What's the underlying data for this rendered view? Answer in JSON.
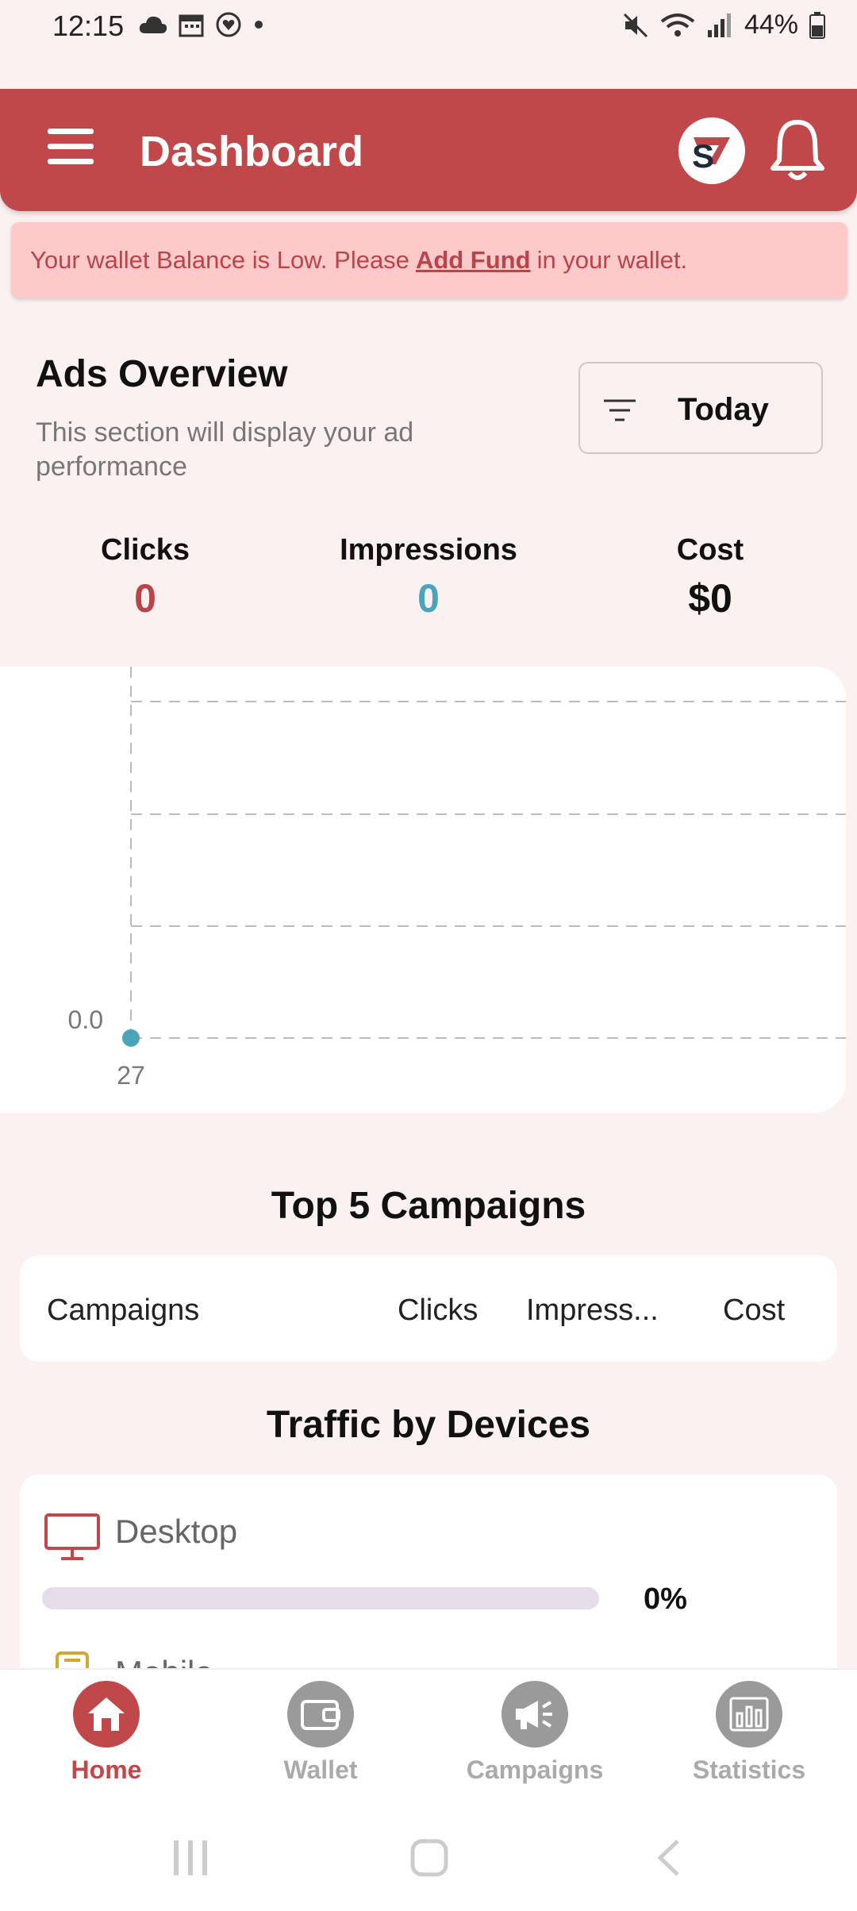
{
  "status_bar": {
    "time": "12:15",
    "battery": "44%"
  },
  "header": {
    "title": "Dashboard",
    "profile_logo_text": "S"
  },
  "alert": {
    "prefix": "Your wallet Balance is Low. Please",
    "link": "Add Fund",
    "suffix": "in your wallet."
  },
  "overview": {
    "title": "Ads Overview",
    "subtitle": "This section will display your ad performance",
    "filter_label": "Today",
    "metrics": [
      {
        "label": "Clicks",
        "value": "0",
        "color": "#b9444a"
      },
      {
        "label": "Impressions",
        "value": "0",
        "color": "#4aa5bb"
      },
      {
        "label": "Cost",
        "value": "$0",
        "color": "#111111"
      }
    ]
  },
  "chart_data": {
    "type": "line",
    "x": [
      27
    ],
    "series": [
      {
        "values": [
          0.0
        ]
      }
    ],
    "y_tick_labels": [
      "0.0"
    ],
    "x_tick_labels": [
      "27"
    ],
    "grid": true,
    "point_color": "#4aa5bb"
  },
  "top_campaigns": {
    "title": "Top 5 Campaigns",
    "columns": [
      "Campaigns",
      "Clicks",
      "Impress...",
      "Cost"
    ]
  },
  "traffic": {
    "title": "Traffic by Devices",
    "devices": [
      {
        "label": "Desktop",
        "percent_text": "0%",
        "percent": 0
      },
      {
        "label": "Mobile"
      }
    ]
  },
  "bottom_nav": {
    "items": [
      {
        "label": "Home",
        "icon": "home-icon",
        "active": true
      },
      {
        "label": "Wallet",
        "icon": "wallet-icon"
      },
      {
        "label": "Campaigns",
        "icon": "megaphone-icon"
      },
      {
        "label": "Statistics",
        "icon": "bar-chart-icon"
      }
    ]
  }
}
